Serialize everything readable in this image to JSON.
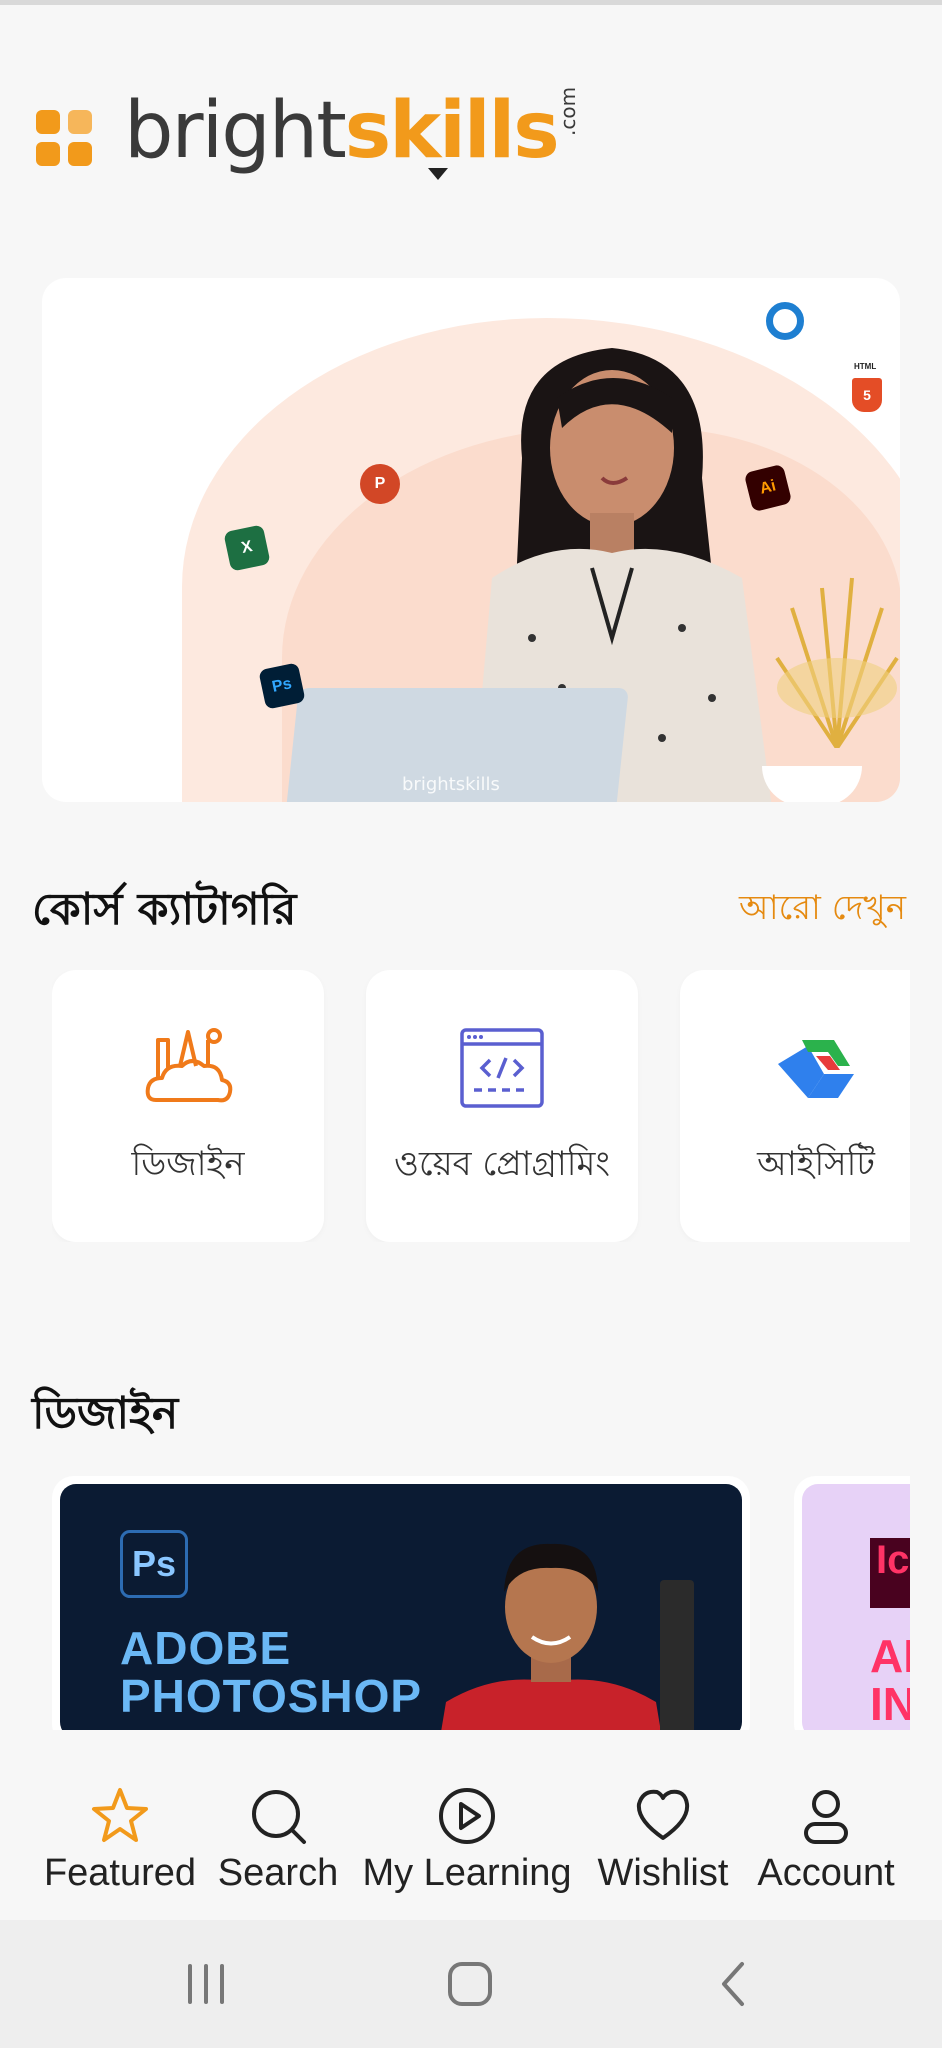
{
  "brand": {
    "name_part1": "bright",
    "name_part2": "skills",
    "domain_suffix": ".com",
    "accent_color": "#f29a1b"
  },
  "hero": {
    "watermark": "brightskills",
    "app_chips": [
      "Ps",
      "X",
      "P",
      "Ai",
      "5",
      "HTML"
    ]
  },
  "categories_section": {
    "title": "কোর্স ক্যাটাগরি",
    "see_more": "আরো দেখুন",
    "items": [
      {
        "label": "ডিজাইন",
        "icon": "design-tools-icon"
      },
      {
        "label": "ওয়েব প্রোগ্রামিং",
        "icon": "code-window-icon"
      },
      {
        "label": "আইসিটি",
        "icon": "ict-logo-icon"
      }
    ]
  },
  "design_section": {
    "title": "ডিজাইন",
    "courses": [
      {
        "badge": "Ps",
        "title_line1": "ADOBE",
        "title_line2": "PHOTOSHOP"
      },
      {
        "badge": "Ic",
        "title_line1": "AI",
        "title_line2": "IN"
      }
    ]
  },
  "tabbar": {
    "items": [
      {
        "label": "Featured",
        "icon": "star-icon",
        "active": true,
        "color": "#f29a1b"
      },
      {
        "label": "Search",
        "icon": "search-icon",
        "active": false
      },
      {
        "label": "My Learning",
        "icon": "play-circle-icon",
        "active": false
      },
      {
        "label": "Wishlist",
        "icon": "heart-icon",
        "active": false
      },
      {
        "label": "Account",
        "icon": "user-icon",
        "active": false
      }
    ]
  },
  "system_nav": [
    "recent-apps-icon",
    "home-icon",
    "back-icon"
  ]
}
